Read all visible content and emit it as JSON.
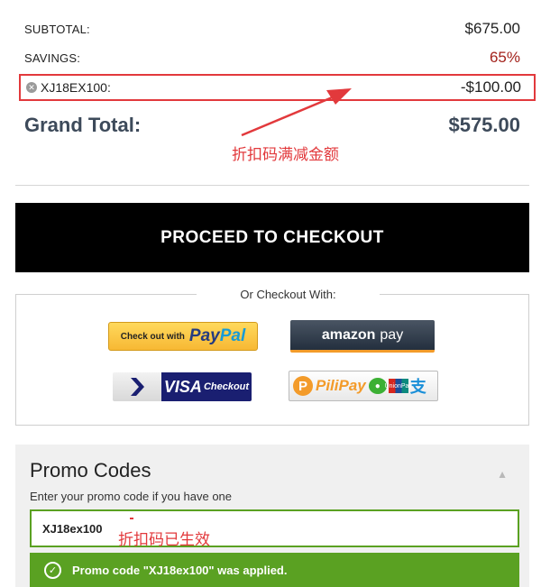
{
  "summary": {
    "subtotal_label": "SUBTOTAL:",
    "subtotal_value": "$675.00",
    "savings_label": "SAVINGS:",
    "savings_value": "65%",
    "promo_line_code": "XJ18EX100:",
    "promo_line_value": "-$100.00",
    "grand_total_label": "Grand Total:",
    "grand_total_value": "$575.00"
  },
  "annotations": {
    "discount_note": "折扣码满减金额",
    "applied_note": "折扣码已生效"
  },
  "checkout": {
    "proceed_label": "PROCEED TO CHECKOUT",
    "alt_title": "Or Checkout With:",
    "paypal_small": "Check out with",
    "paypal_big_1": "Pay",
    "paypal_big_2": "Pal",
    "amazon_1": "amazon",
    "amazon_2": "pay",
    "visa_big": "VISA",
    "visa_small": "Checkout",
    "pili_text": "PiliPay",
    "pili_union": "UnionPay",
    "pili_ali": "支"
  },
  "promo": {
    "title": "Promo Codes",
    "subtitle": "Enter your promo code if you have one",
    "input_value": "XJ18ex100",
    "success_message": "Promo code \"XJ18ex100\" was applied."
  },
  "icons": {
    "remove": "remove-circle-icon",
    "collapse": "caret-up-icon",
    "success": "check-circle-icon",
    "visa_arrow": "chevron-right-icon"
  },
  "colors": {
    "savings_red": "#a3221c",
    "annotation_red": "#e2393c",
    "grand_total": "#3d4a5a",
    "success_green": "#5aa122",
    "checkout_black": "#000000"
  }
}
